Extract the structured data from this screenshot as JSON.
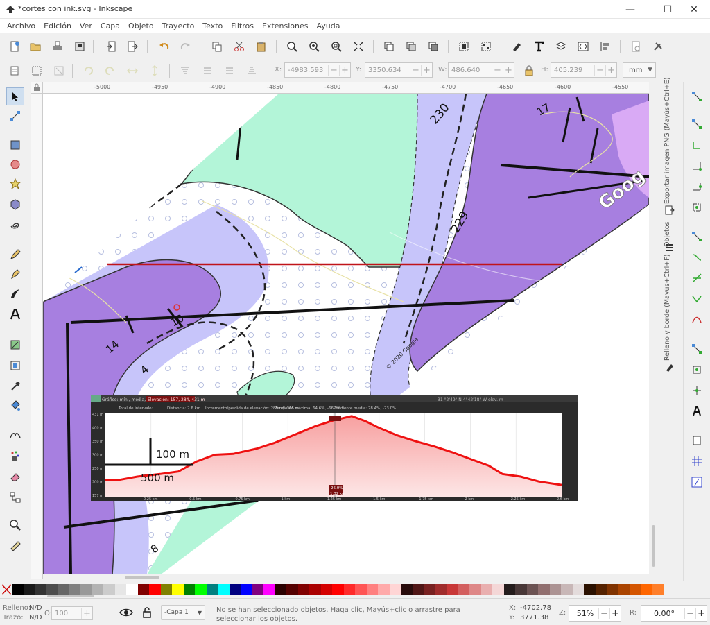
{
  "window": {
    "title": "*cortes con ink.svg - Inkscape",
    "minimize": "—",
    "maximize": "☐",
    "close": "✕"
  },
  "menu": [
    "Archivo",
    "Edición",
    "Ver",
    "Capa",
    "Objeto",
    "Trayecto",
    "Texto",
    "Filtros",
    "Extensiones",
    "Ayuda"
  ],
  "toolcontrols": {
    "x_label": "X:",
    "x_value": "-4983.593",
    "y_label": "Y:",
    "y_value": "3350.634",
    "w_label": "W:",
    "w_value": "486.640",
    "h_label": "H:",
    "h_value": "405.239",
    "unit": "mm"
  },
  "ruler": {
    "ticks": [
      "-5000",
      "-4950",
      "-4900",
      "-4850",
      "-4800",
      "-4750",
      "-4700",
      "-4650",
      "-4600",
      "-4550"
    ]
  },
  "map": {
    "contour_labels": [
      "230",
      "229",
      "17",
      "10",
      "14",
      "4",
      "8"
    ],
    "watermark": "Goog",
    "copyright": "© 2020 Google"
  },
  "profile": {
    "header_left": "Gráfico: mín., media, máx.",
    "header_elev": "Elevación: 157, 284, 431 m",
    "header_right": "31 °2'49\" N 4°42'18\" W   elev.   m",
    "stats": {
      "total": "Total de intervalo:",
      "distance": "Distancia: 2.6 km",
      "gain": "Incremento/pérdida de elevación: 289 m, -305 m",
      "max_slope": "Pendiente máxima: 64.6%, -66.2%",
      "avg_slope": "Pendiente media: 28.4%, -23.0%"
    },
    "y_ticks": [
      "431 m",
      "400 m",
      "350 m",
      "300 m",
      "250 m",
      "200 m",
      "157 m"
    ],
    "x_ticks": [
      "0.25 km",
      "0.5 km",
      "0.75 km",
      "1 km",
      "1.25 km",
      "1.5 km",
      "1.75 km",
      "2 km",
      "2.25 km",
      "2.6 km"
    ],
    "marker_x": "1.32 km",
    "marker_pct": "26.0%",
    "scale_v": "100 m",
    "scale_h": "500 m"
  },
  "status": {
    "fill_label": "Relleno:",
    "fill_value": "N/D",
    "stroke_label": "Trazo:",
    "stroke_value": "N/D",
    "opacity_label": "O:",
    "opacity_value": "100",
    "layer": "-Capa 1",
    "message": "No se han seleccionado objetos. Haga clic, Mayús+clic o arrastre para seleccionar los objetos.",
    "x_label": "X:",
    "x_value": "-4702.78",
    "y_label": "Y:",
    "y_value": "3771.38",
    "z_label": "Z:",
    "zoom": "51%",
    "r_label": "R:",
    "rotation": "0.00°"
  },
  "dock": {
    "fill_stroke": "Relleno y borde (Mayús+Ctrl+F)",
    "objects": "Objetos",
    "export": "Exportar imagen PNG (Mayús+Ctrl+E)"
  },
  "palette_colors": [
    "#000000",
    "#1a1a1a",
    "#333333",
    "#4d4d4d",
    "#666666",
    "#808080",
    "#999999",
    "#b3b3b3",
    "#cccccc",
    "#e6e6e6",
    "#ffffff",
    "#800000",
    "#ff0000",
    "#808000",
    "#ffff00",
    "#008000",
    "#00ff00",
    "#008080",
    "#00ffff",
    "#000080",
    "#0000ff",
    "#800080",
    "#ff00ff",
    "#2b0000",
    "#550000",
    "#800000",
    "#aa0000",
    "#d40000",
    "#ff0000",
    "#ff2a2a",
    "#ff5555",
    "#ff8080",
    "#ffaaaa",
    "#ffd5d5",
    "#280b0b",
    "#501616",
    "#782121",
    "#a02c2c",
    "#c83737",
    "#d35f5f",
    "#de8787",
    "#e9afaf",
    "#f4d7d7",
    "#241c1c",
    "#483737",
    "#6c5353",
    "#916f6f",
    "#ac9393",
    "#c8b7b7",
    "#e3dbdb",
    "#2b1100",
    "#552200",
    "#803300",
    "#aa4400",
    "#d45500",
    "#ff6600",
    "#ff7f2a"
  ]
}
